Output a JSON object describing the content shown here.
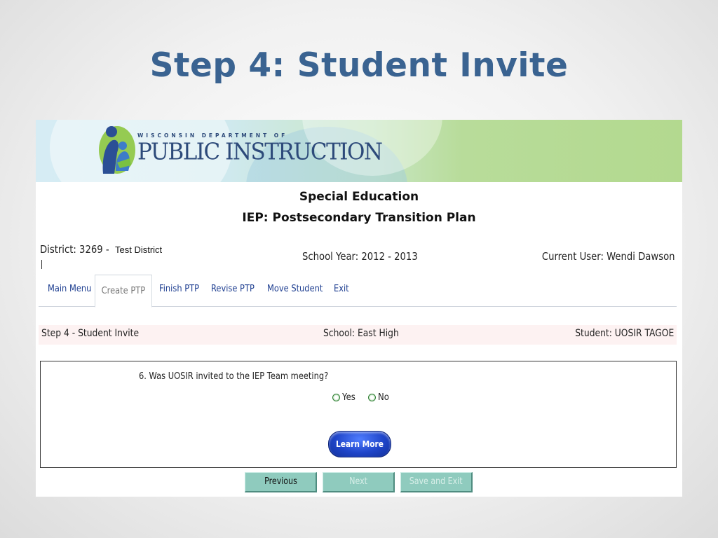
{
  "slide": {
    "title": "Step 4: Student Invite"
  },
  "banner": {
    "org_line1": "WISCONSIN DEPARTMENT OF",
    "org_line2": "PUBLIC INSTRUCTION"
  },
  "app": {
    "title1": "Special Education",
    "title2": "IEP: Postsecondary Transition Plan"
  },
  "header": {
    "district": "District: 3269 -",
    "district_name": "Test District",
    "school_year": "School Year: 2012 - 2013",
    "current_user": "Current User: Wendi Dawson"
  },
  "tabs": [
    {
      "label": "Main Menu"
    },
    {
      "label": "Create PTP"
    },
    {
      "label": "Finish PTP"
    },
    {
      "label": "Revise PTP"
    },
    {
      "label": "Move Student"
    },
    {
      "label": "Exit"
    }
  ],
  "active_tab": "Create PTP",
  "step_bar": {
    "step": "Step 4 - Student Invite",
    "school": "School: East High",
    "student": "Student: UOSIR TAGOE"
  },
  "question": {
    "text": "6.  Was UOSIR invited to the IEP Team meeting?",
    "options": [
      {
        "label": "Yes"
      },
      {
        "label": "No"
      }
    ],
    "learn_more": "Learn More"
  },
  "nav": {
    "previous": "Previous",
    "next": "Next",
    "save_exit": "Save and Exit"
  },
  "colors": {
    "title_blue": "#3a6391",
    "tab_link": "#1f3f91",
    "nav_button": "#8fcbbe",
    "learn_button": "#1f45c9"
  }
}
